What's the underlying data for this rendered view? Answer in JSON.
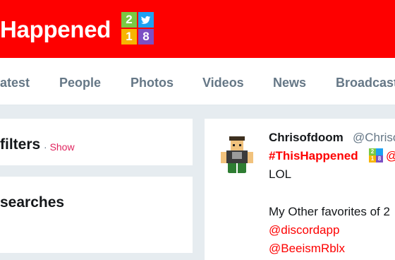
{
  "header": {
    "hashtag_title": "Happened",
    "badge": {
      "top_left": "2",
      "bottom_left": "1",
      "bottom_right": "8",
      "top_right_icon": "twitter-bird-icon"
    },
    "colors": {
      "brand_red": "#fe0000",
      "badge_green": "#7ac943",
      "badge_blue": "#1da1f2",
      "badge_yellow": "#f7b500",
      "badge_purple": "#7b50c4"
    }
  },
  "nav": {
    "tabs": [
      "atest",
      "People",
      "Photos",
      "Videos",
      "News",
      "Broadcast"
    ]
  },
  "sidebar": {
    "filters_title": "filters",
    "filters_separator": "·",
    "filters_show": "Show",
    "searches_title": "searches"
  },
  "tweet": {
    "name": "Chrisofdoom",
    "handle": "@Chriso",
    "hashtag": "#ThisHappened",
    "at_fragment": "@",
    "line1": "LOL",
    "line2": "My Other favorites of 2",
    "mention1": "@discordapp",
    "mention2": "@BeeismRblx"
  }
}
